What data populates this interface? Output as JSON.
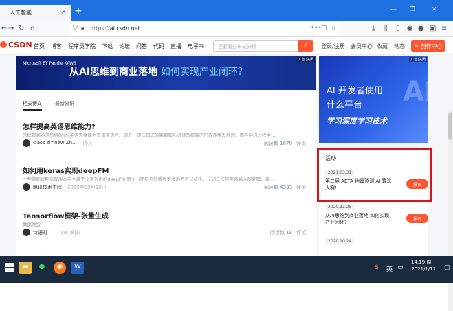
{
  "browser": {
    "tab_title": "人工智能",
    "url_prefix": "https://",
    "url_host": "ai.csdn.net"
  },
  "csdn": {
    "logo": "CSDN",
    "nav": [
      "首页",
      "博客",
      "程序员学院",
      "下载",
      "论坛",
      "问答",
      "代码",
      "直播",
      "电子书"
    ],
    "search_placeholder": "还要看分布式分析",
    "right": [
      "登录/注册",
      "会员中心",
      "收藏",
      "动态"
    ],
    "create": "创作中心"
  },
  "banner": {
    "brands": "Microsoft  EY  Paddle  KAWS",
    "title": "从AI思维到商业落地",
    "subtitle": "如何实现产业闭环？",
    "ad_tag": "广告|关闭"
  },
  "tabs": [
    "相关博文",
    "最新资讯"
  ],
  "articles": [
    {
      "title": "怎样提高英语思维能力?",
      "desc": "怎样提高英语思维能力?英语思维能力是母语语言、词汇、语法知识的掌握和听说读写技能的形成逐步发展的。而在学习过程中…",
      "author": "class zl=new Zh…",
      "time": "昨天",
      "reads_label": "阅读数",
      "reads": "1070",
      "comment": "评论"
    },
    {
      "title": "如何用keras实现deepFM",
      "desc": "一些前面说明实现版本完全基于文末列出的deepFM 原文（还有几处或者更多地方可以优化。比如二次项多路输入的处理，将…",
      "author": "腾讯技术工程",
      "time": "2019年09月18日",
      "reads_label": "阅读数",
      "reads": "4333",
      "comment": "评论"
    },
    {
      "title": "Tensorflow框架-张量生成",
      "desc": "数据类型",
      "author": "诗语时",
      "time": "19小时前",
      "reads_label": "阅读数",
      "reads": "18",
      "comment": "评论"
    }
  ],
  "side_ad": {
    "line1": "AI 开发者使用",
    "line2": "什么平台",
    "line3": "学习深度学习技术",
    "mark": "AI",
    "tag": "广告|关闭"
  },
  "activity": {
    "header": "活动",
    "items": [
      {
        "date": "2021.03.31",
        "text": "第二届 AETA 地震预测 AI 算法大赛!",
        "button": "报名"
      },
      {
        "date": "2020.12.25",
        "text": "从AI思维到商业落地 如何实现产业闭环?",
        "button": "报名"
      },
      {
        "date": "2020.10.24",
        "text": "",
        "button": ""
      }
    ]
  },
  "taskbar": {
    "time": "14:19 周一",
    "date": "2021/1/11",
    "lang": "英"
  }
}
